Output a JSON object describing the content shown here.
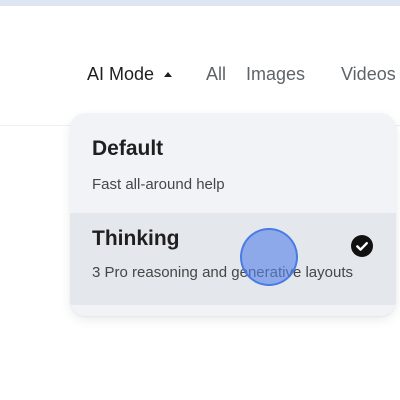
{
  "tabs": {
    "ai_mode": "AI Mode",
    "all": "All",
    "images": "Images",
    "videos": "Videos"
  },
  "dropdown": {
    "options": [
      {
        "title": "Default",
        "description": "Fast all-around help",
        "selected": false
      },
      {
        "title": "Thinking",
        "description": "3 Pro reasoning and generative layouts",
        "selected": true
      }
    ]
  },
  "icons": {
    "caret": "caret-up-icon",
    "check": "check-circle-icon"
  },
  "colors": {
    "dropdown_bg": "#f1f3f7",
    "selected_option_bg": "#e4e7ec",
    "check": "#111111",
    "cursor_highlight": "#5882e8"
  }
}
